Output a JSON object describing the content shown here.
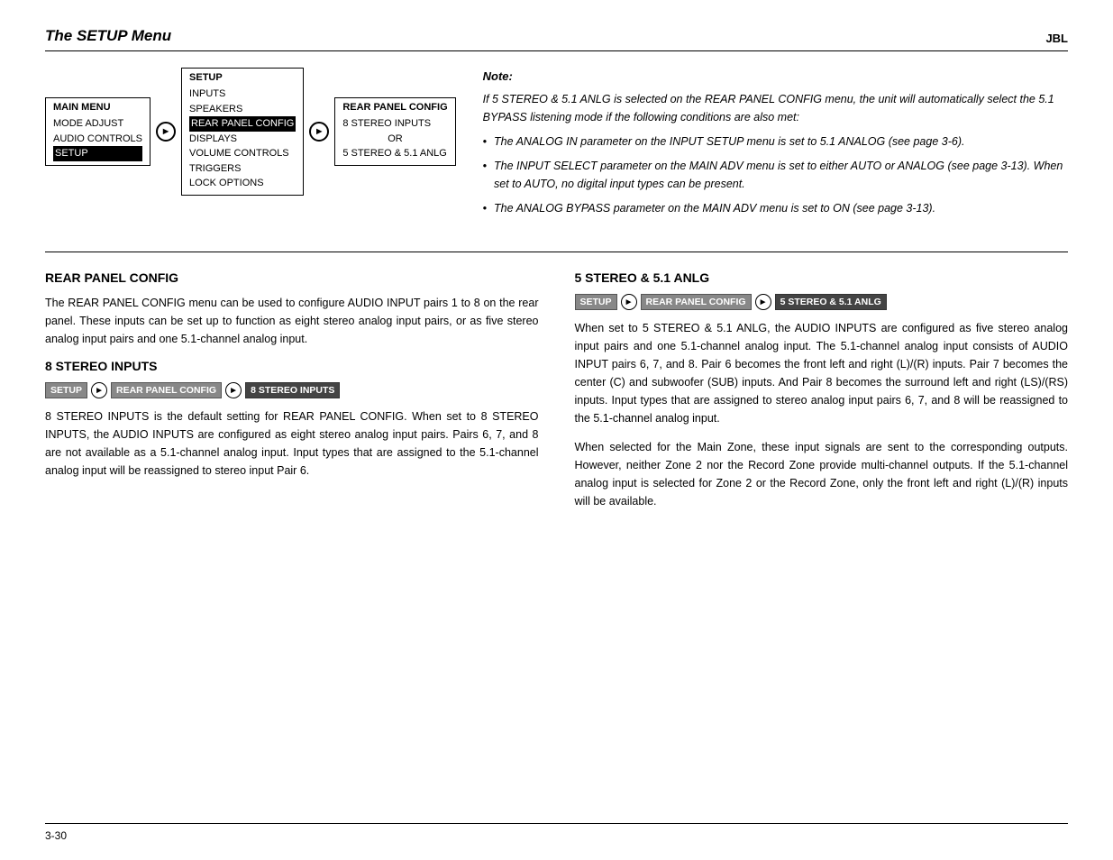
{
  "header": {
    "title": "The SETUP Menu",
    "brand": "JBL"
  },
  "menu_diagram": {
    "main_menu": {
      "header": "MAIN MENU",
      "items": [
        "MODE ADJUST",
        "AUDIO CONTROLS",
        "SETUP"
      ],
      "selected": "SETUP"
    },
    "setup_menu": {
      "header": "SETUP",
      "items": [
        "INPUTS",
        "SPEAKERS",
        "REAR PANEL CONFIG",
        "DISPLAYS",
        "VOLUME CONTROLS",
        "TRIGGERS",
        "LOCK OPTIONS"
      ],
      "selected": "REAR PANEL CONFIG"
    },
    "rear_panel_menu": {
      "header": "REAR PANEL CONFIG",
      "items": [
        "8 STEREO INPUTS",
        "OR",
        "5 STEREO & 5.1 ANLG"
      ]
    }
  },
  "note": {
    "title": "Note:",
    "intro": "If 5 STEREO & 5.1 ANLG is selected on the REAR PANEL CONFIG menu, the unit will automatically select the 5.1 BYPASS listening mode if the following conditions are also met:",
    "bullets": [
      "The ANALOG IN parameter on the INPUT SETUP menu is set to 5.1 ANALOG (see page 3-6).",
      "The INPUT SELECT parameter on the MAIN ADV menu is set to either AUTO or ANALOG (see page 3-13).  When set to AUTO, no digital input types can be present.",
      "The ANALOG  BYPASS parameter on the MAIN ADV menu is set to ON (see page 3-13)."
    ]
  },
  "section_left": {
    "title": "REAR PANEL CONFIG",
    "intro": "The REAR PANEL CONFIG menu can be used to configure AUDIO INPUT pairs 1 to 8 on the rear panel. These inputs can be set up to function as eight stereo analog input pairs, or as five stereo analog input pairs and one 5.1-channel analog input.",
    "subsection_title": "8 STEREO INPUTS",
    "breadcrumb": [
      "SETUP",
      "REAR PANEL CONFIG",
      "8 STEREO INPUTS"
    ],
    "body": "8 STEREO INPUTS is the default setting for REAR PANEL CONFIG. When set to 8 STEREO INPUTS, the AUDIO INPUTS are configured as eight stereo analog input pairs. Pairs 6, 7, and 8 are not available as a 5.1-channel analog input. Input types that are assigned to the 5.1-channel analog input will be reassigned to stereo input Pair 6."
  },
  "section_right": {
    "title": "5 STEREO & 5.1 ANLG",
    "breadcrumb": [
      "SETUP",
      "REAR PANEL CONFIG",
      "5 STEREO & 5.1 ANLG"
    ],
    "body1": "When set to 5 STEREO & 5.1 ANLG, the AUDIO INPUTS are configured as five stereo analog input pairs and one 5.1-channel analog input. The 5.1-channel analog input consists of AUDIO INPUT pairs 6, 7, and 8.  Pair 6 becomes the front left and right (L)/(R) inputs.  Pair 7 becomes the center (C) and subwoofer (SUB) inputs. And Pair 8 becomes the surround left and right (LS)/(RS) inputs.  Input types that are assigned to stereo analog input pairs 6, 7, and 8 will be reassigned to the 5.1-channel analog input.",
    "body2": "When selected for the Main Zone, these input signals are sent to the corresponding outputs. However, neither Zone 2 nor the Record Zone provide multi-channel outputs. If the 5.1-channel analog input is selected for Zone 2 or the Record Zone, only the front left and right (L)/(R) inputs will be available."
  },
  "footer": {
    "page": "3-30"
  }
}
